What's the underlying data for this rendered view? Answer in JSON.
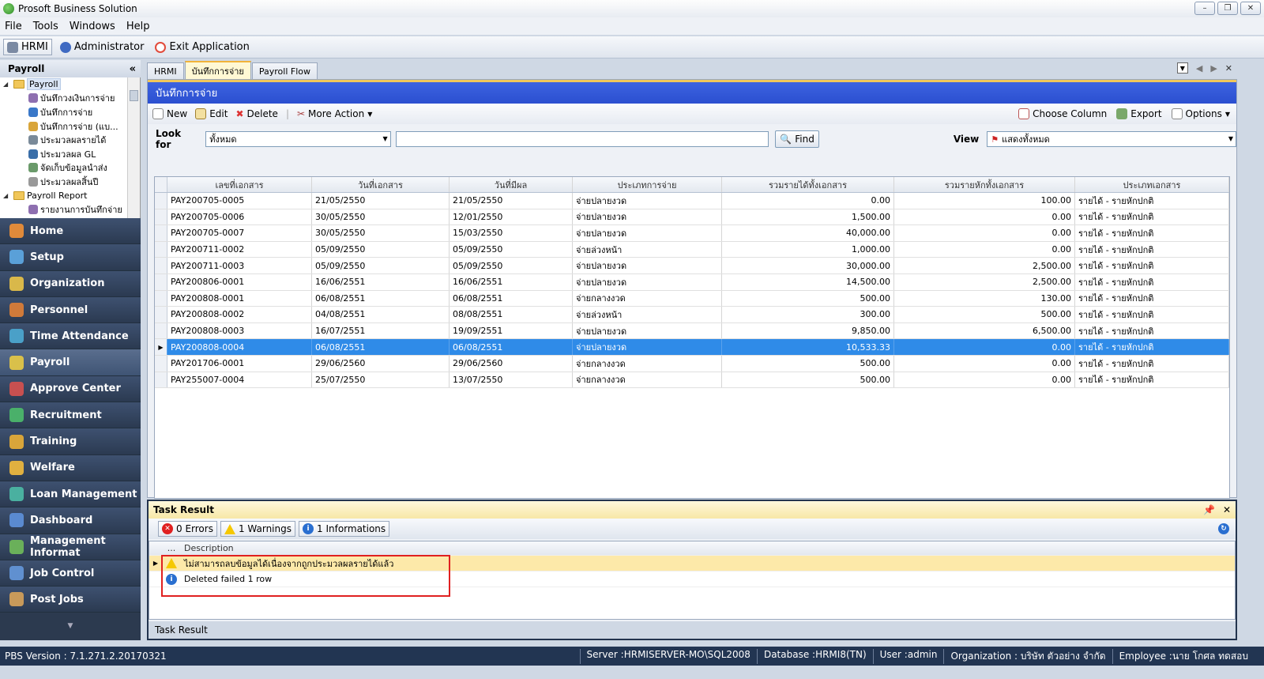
{
  "window": {
    "title": "Prosoft Business Solution"
  },
  "menu": [
    "File",
    "Tools",
    "Windows",
    "Help"
  ],
  "toolbar": {
    "hrmi": "HRMI",
    "admin": "Administrator",
    "exit": "Exit Application"
  },
  "left": {
    "header": "Payroll",
    "tree": [
      {
        "label": "Payroll",
        "level": 0
      },
      {
        "label": "บันทึกวงเงินการจ่าย",
        "level": 1
      },
      {
        "label": "บันทึกการจ่าย",
        "level": 1
      },
      {
        "label": "บันทึกการจ่าย (แบ...",
        "level": 1
      },
      {
        "label": "ประมวลผลรายได้",
        "level": 1
      },
      {
        "label": "ประมวลผล GL",
        "level": 1
      },
      {
        "label": "จัดเก็บข้อมูลนำส่ง",
        "level": 1
      },
      {
        "label": "ประมวลผลสิ้นปี",
        "level": 1
      },
      {
        "label": "Payroll Report",
        "level": 0
      },
      {
        "label": "รายงานการบันทึกจ่าย",
        "level": 1
      }
    ],
    "nav": [
      "Home",
      "Setup",
      "Organization",
      "Personnel",
      "Time Attendance",
      "Payroll",
      "Approve Center",
      "Recruitment",
      "Training",
      "Welfare",
      "Loan Management",
      "Dashboard",
      "Management Informat",
      "Job Control",
      "Post Jobs"
    ],
    "nav_active": "Payroll"
  },
  "tabs": [
    "HRMI",
    "บันทึกการจ่าย",
    "Payroll Flow"
  ],
  "form": {
    "title": "บันทึกการจ่าย",
    "actions": {
      "new": "New",
      "edit": "Edit",
      "delete": "Delete",
      "more": "More Action",
      "choose": "Choose Column",
      "export": "Export",
      "options": "Options"
    },
    "look_for_label": "Look for",
    "look_for_value": "ทั้งหมด",
    "search_value": "",
    "find": "Find",
    "view_label": "View",
    "view_value": "แสดงทั้งหมด"
  },
  "grid": {
    "columns": [
      "เลขที่เอกสาร",
      "วันที่เอกสาร",
      "วันที่มีผล",
      "ประเภทการจ่าย",
      "รวมรายได้ทั้งเอกสาร",
      "รวมรายหักทั้งเอกสาร",
      "ประเภทเอกสาร"
    ],
    "rows": [
      [
        "PAY200705-0005",
        "21/05/2550",
        "21/05/2550",
        "จ่ายปลายงวด",
        "0.00",
        "100.00",
        "รายได้ - รายหักปกติ"
      ],
      [
        "PAY200705-0006",
        "30/05/2550",
        "12/01/2550",
        "จ่ายปลายงวด",
        "1,500.00",
        "0.00",
        "รายได้ - รายหักปกติ"
      ],
      [
        "PAY200705-0007",
        "30/05/2550",
        "15/03/2550",
        "จ่ายปลายงวด",
        "40,000.00",
        "0.00",
        "รายได้ - รายหักปกติ"
      ],
      [
        "PAY200711-0002",
        "05/09/2550",
        "05/09/2550",
        "จ่ายล่วงหน้า",
        "1,000.00",
        "0.00",
        "รายได้ - รายหักปกติ"
      ],
      [
        "PAY200711-0003",
        "05/09/2550",
        "05/09/2550",
        "จ่ายปลายงวด",
        "30,000.00",
        "2,500.00",
        "รายได้ - รายหักปกติ"
      ],
      [
        "PAY200806-0001",
        "16/06/2551",
        "16/06/2551",
        "จ่ายปลายงวด",
        "14,500.00",
        "2,500.00",
        "รายได้ - รายหักปกติ"
      ],
      [
        "PAY200808-0001",
        "06/08/2551",
        "06/08/2551",
        "จ่ายกลางงวด",
        "500.00",
        "130.00",
        "รายได้ - รายหักปกติ"
      ],
      [
        "PAY200808-0002",
        "04/08/2551",
        "08/08/2551",
        "จ่ายล่วงหน้า",
        "300.00",
        "500.00",
        "รายได้ - รายหักปกติ"
      ],
      [
        "PAY200808-0003",
        "16/07/2551",
        "19/09/2551",
        "จ่ายปลายงวด",
        "9,850.00",
        "6,500.00",
        "รายได้ - รายหักปกติ"
      ],
      [
        "PAY200808-0004",
        "06/08/2551",
        "06/08/2551",
        "จ่ายปลายงวด",
        "10,533.33",
        "0.00",
        "รายได้ - รายหักปกติ"
      ],
      [
        "PAY201706-0001",
        "29/06/2560",
        "29/06/2560",
        "จ่ายกลางงวด",
        "500.00",
        "0.00",
        "รายได้ - รายหักปกติ"
      ],
      [
        "PAY255007-0004",
        "25/07/2550",
        "13/07/2550",
        "จ่ายกลางงวด",
        "500.00",
        "0.00",
        "รายได้ - รายหักปกติ"
      ]
    ],
    "selected_index": 9
  },
  "task": {
    "title": "Task Result",
    "errors": "0 Errors",
    "warnings": "1 Warnings",
    "infos": "1 Informations",
    "col_dots": "...",
    "col_desc": "Description",
    "messages": [
      {
        "type": "warning",
        "text": "ไม่สามารถลบข้อมูลได้เนื่องจากถูกประมวลผลรายได้แล้ว"
      },
      {
        "type": "info",
        "text": "Deleted failed 1 row"
      }
    ],
    "footer_tab": "Task Result"
  },
  "status": {
    "version": "PBS Version : 7.1.271.2.20170321",
    "server": "Server :HRMISERVER-MO\\SQL2008",
    "database": "Database :HRMI8(TN)",
    "user": "User :admin",
    "org": "Organization : บริษัท ตัวอย่าง จำกัด",
    "employee": "Employee :นาย โกศล ทดสอบ"
  },
  "colors": {
    "accent": "#2b4fd0",
    "selected_row": "#2f8be8",
    "nav_bg": "#2c3a4f",
    "highlight": "#e02020"
  }
}
